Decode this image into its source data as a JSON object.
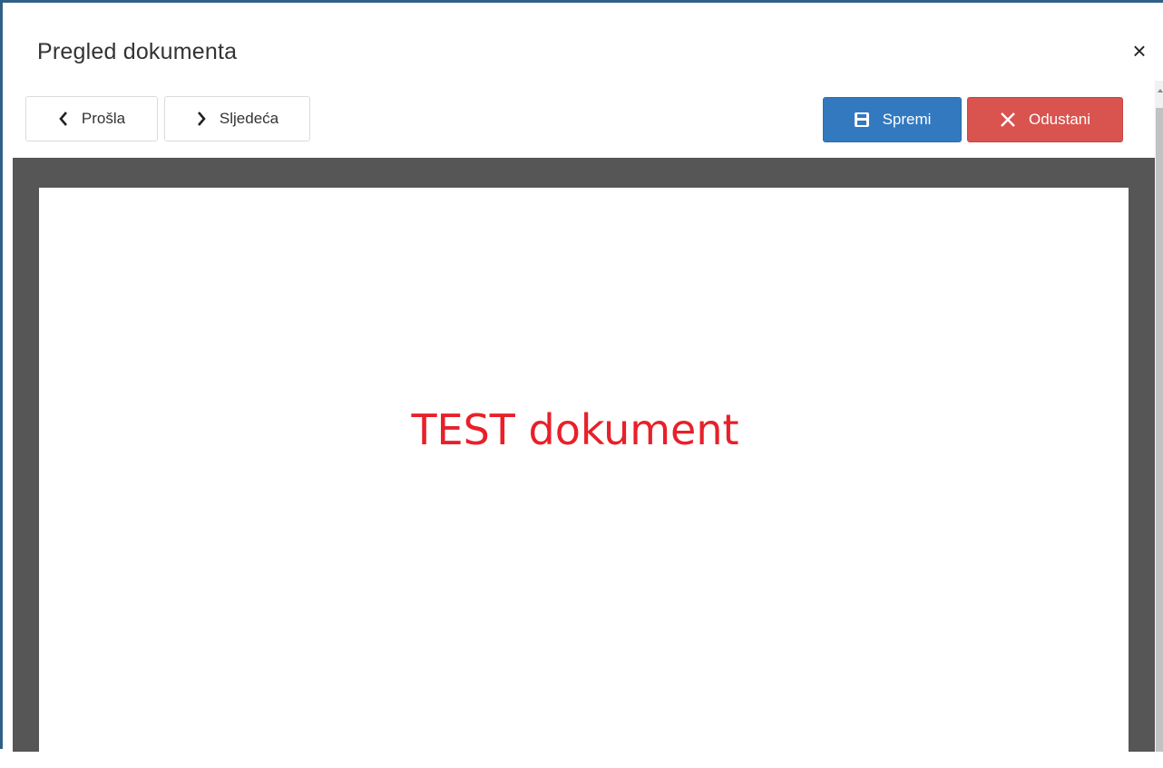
{
  "dialog": {
    "title": "Pregled dokumenta",
    "close_label": "×"
  },
  "toolbar": {
    "prev_label": "Prošla",
    "next_label": "Sljedeća",
    "save_label": "Spremi",
    "cancel_label": "Odustani"
  },
  "icons": {
    "prev": "chevron-left-icon",
    "next": "chevron-right-icon",
    "save": "floppy-disk-icon",
    "cancel": "close-x-icon"
  },
  "document": {
    "content_text": "TEST dokument"
  },
  "colors": {
    "accent_primary": "#3379bf",
    "accent_danger": "#d9534f",
    "document_text": "#e8202a",
    "viewer_background": "#565656",
    "window_border": "#2f5f86"
  }
}
